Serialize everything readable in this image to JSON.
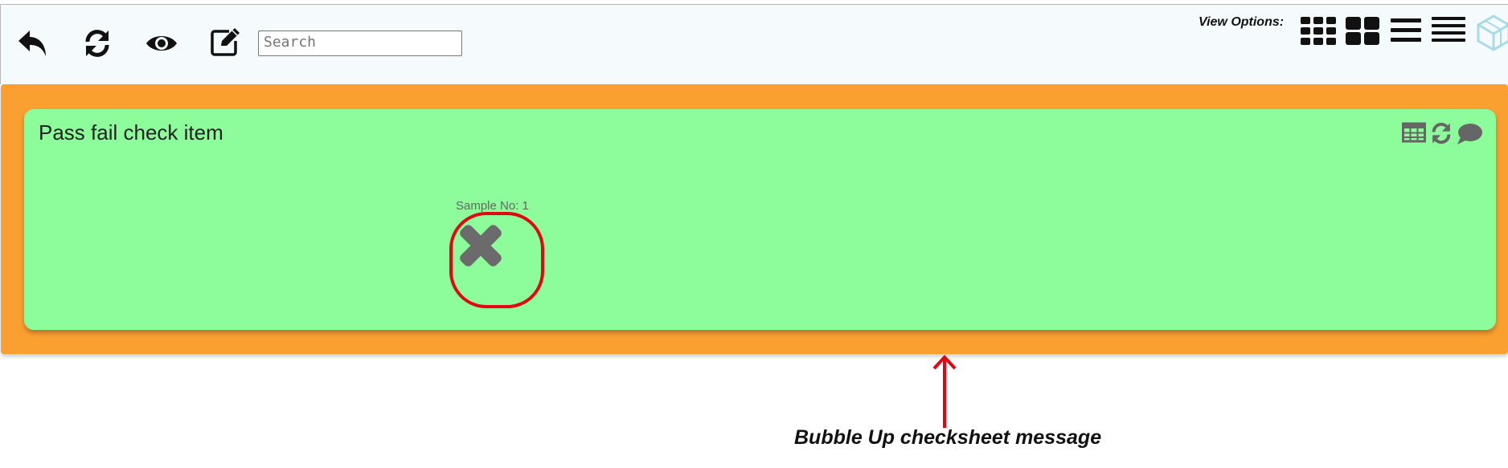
{
  "toolbar": {
    "search": {
      "placeholder": "Search",
      "value": ""
    },
    "icons": {
      "undo": "undo-icon",
      "refresh": "refresh-icon",
      "preview": "eye-icon",
      "edit": "edit-icon"
    },
    "view_options": {
      "label": "View Options:",
      "buttons": [
        "grid-small-icon",
        "grid-large-icon",
        "list-icon",
        "list-compact-icon"
      ]
    }
  },
  "colors": {
    "toolbar_bg": "#f5fbfd",
    "band": "#f9a030",
    "card": "#8dfc9a",
    "fail_icon": "#6b6b6b",
    "highlight": "#e30613"
  },
  "card": {
    "title": "Pass fail check item",
    "header_icons": [
      "table-icon",
      "refresh-icon",
      "comment-icon"
    ],
    "sample": {
      "label": "Sample No: 1",
      "status_icon": "fail-x-icon"
    }
  },
  "annotation": {
    "caption": "Bubble Up checksheet message"
  }
}
